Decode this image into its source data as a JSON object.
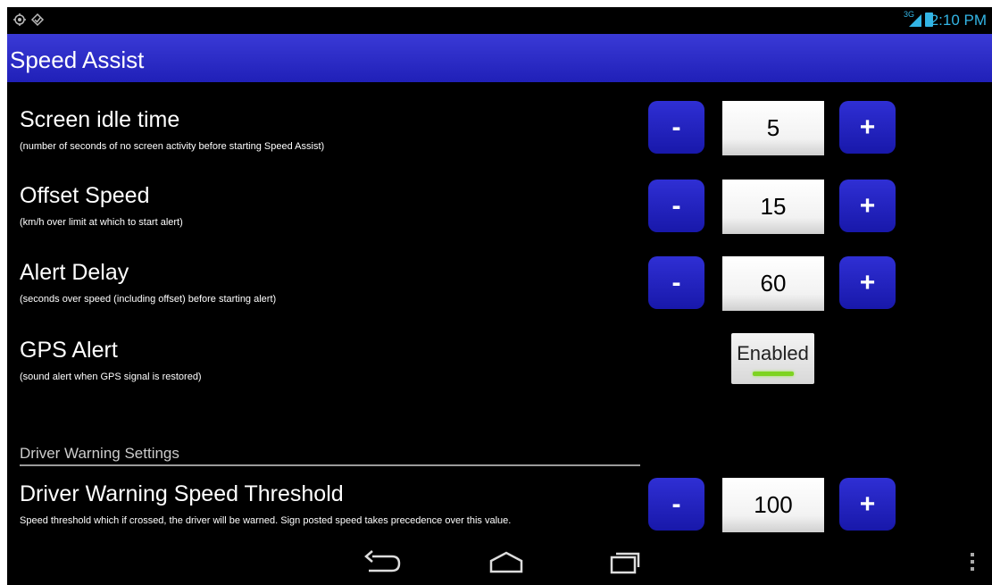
{
  "status_bar": {
    "time": "2:10 PM",
    "network": "3G",
    "icons": [
      "gps-icon",
      "sync-icon",
      "signal-icon",
      "battery-icon"
    ]
  },
  "action_bar": {
    "title": "Speed Assist"
  },
  "settings": [
    {
      "title": "Screen idle time",
      "description": "(number of seconds of no screen activity before starting Speed Assist)",
      "value": "5",
      "minus_label": "-",
      "plus_label": "+"
    },
    {
      "title": "Offset Speed",
      "description": "(km/h over limit at which to start alert)",
      "value": "15",
      "minus_label": "-",
      "plus_label": "+"
    },
    {
      "title": "Alert Delay",
      "description": "(seconds over speed (including offset) before starting alert)",
      "value": "60",
      "minus_label": "-",
      "plus_label": "+"
    }
  ],
  "gps_alert": {
    "title": "GPS Alert",
    "description": "(sound alert when GPS signal is restored)",
    "toggle_label": "Enabled",
    "enabled": true
  },
  "driver_warning": {
    "section_header": "Driver Warning Settings",
    "title": "Driver Warning Speed Threshold",
    "description": "Speed threshold which if crossed, the driver will be warned. Sign posted speed takes precedence over this value.",
    "value": "100",
    "minus_label": "-",
    "plus_label": "+"
  },
  "nav_bar": {
    "buttons": [
      "back-icon",
      "home-icon",
      "recent-apps-icon"
    ],
    "overflow": "overflow-menu-icon"
  },
  "colors": {
    "action_bar": "#2a2ac8",
    "button": "#2020bc",
    "status_accent": "#33b5e5",
    "toggle_on": "#7ed321"
  }
}
